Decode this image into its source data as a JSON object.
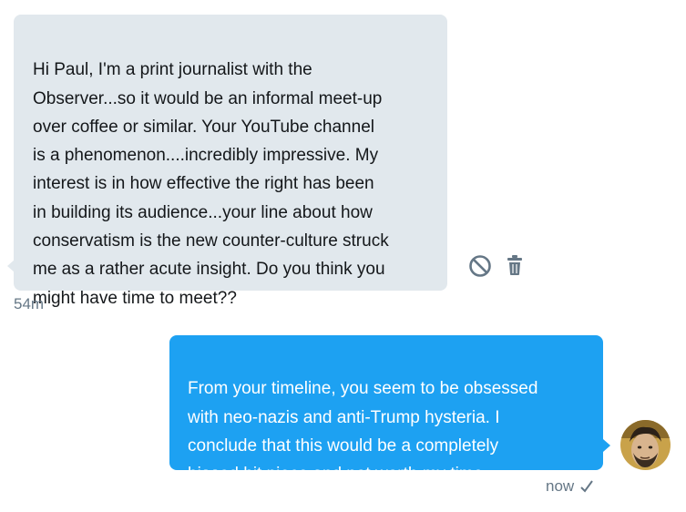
{
  "conversation": {
    "incoming": {
      "text": "Hi Paul, I'm a print journalist with the\nObserver...so it would be an informal meet-up\nover coffee or similar. Your YouTube channel\nis a phenomenon....incredibly impressive. My\ninterest is in how effective the right has been\nin building its audience...your line about how\nconservatism is the new counter-culture struck\nme as a rather acute insight. Do you think you\nmight have time to meet??",
      "timestamp": "54m",
      "actions": [
        {
          "icon": "block-icon"
        },
        {
          "icon": "trash-icon"
        }
      ],
      "bubble_color": "#e1e8ed",
      "text_color": "#14171a"
    },
    "outgoing": {
      "text": "From your timeline, you seem to be obsessed\nwith neo-nazis and anti-Trump hysteria. I\nconclude that this would be a completely\nbiased hit piece and not worth my time.",
      "timestamp": "now",
      "status_icon": "checkmark-icon",
      "bubble_color": "#1da1f2",
      "text_color": "#ffffff",
      "avatar_icon": "avatar"
    }
  },
  "colors": {
    "muted_text": "#657786",
    "icon_gray": "#657786"
  }
}
